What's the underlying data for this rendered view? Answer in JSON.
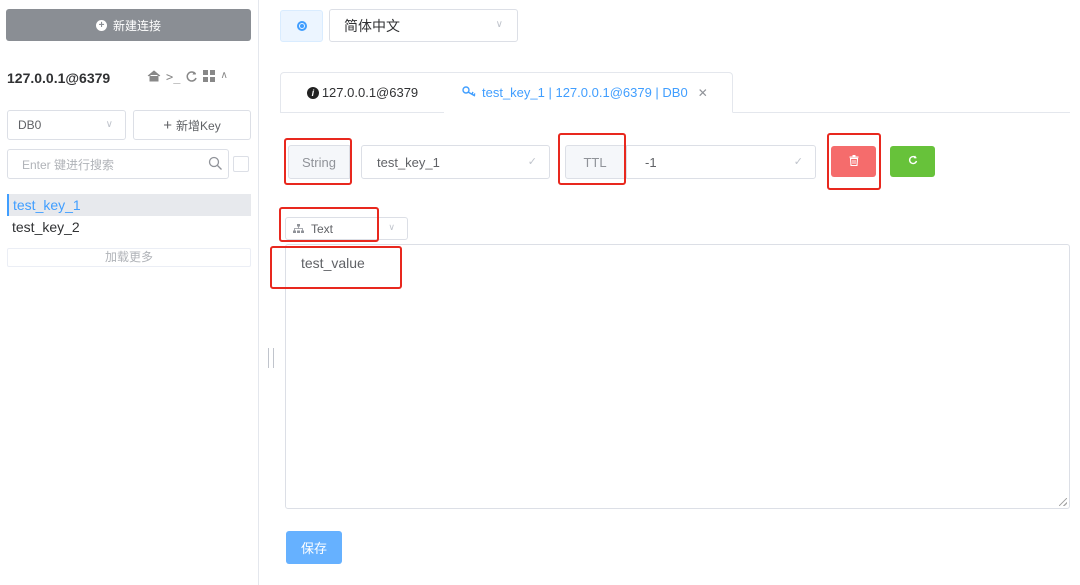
{
  "sidebar": {
    "new_connection_label": "新建连接",
    "connection_title": "127.0.0.1@6379",
    "db_select_value": "DB0",
    "add_key_label": "新增Key",
    "search_placeholder": "Enter 键进行搜索",
    "keys": [
      {
        "name": "test_key_1",
        "selected": true
      },
      {
        "name": "test_key_2",
        "selected": false
      }
    ],
    "load_more_label": "加载更多",
    "icons": [
      "home-icon",
      "terminal-icon",
      "refresh-icon",
      "grid-icon",
      "chevron-up-icon"
    ]
  },
  "header": {
    "language_value": "简体中文"
  },
  "tabs": [
    {
      "label": "127.0.0.1@6379",
      "icon": "info-icon",
      "active": false
    },
    {
      "label": "test_key_1 | 127.0.0.1@6379 | DB0",
      "icon": "key-icon",
      "active": true,
      "closable": true
    }
  ],
  "key_detail": {
    "type": "String",
    "key_name": "test_key_1",
    "ttl_label": "TTL",
    "ttl_value": "-1",
    "format_value": "Text",
    "value": "test_value",
    "save_label": "保存"
  },
  "colors": {
    "primary": "#409eff",
    "danger": "#f56c6c",
    "success": "#67c23a",
    "highlight": "#e8281e"
  }
}
